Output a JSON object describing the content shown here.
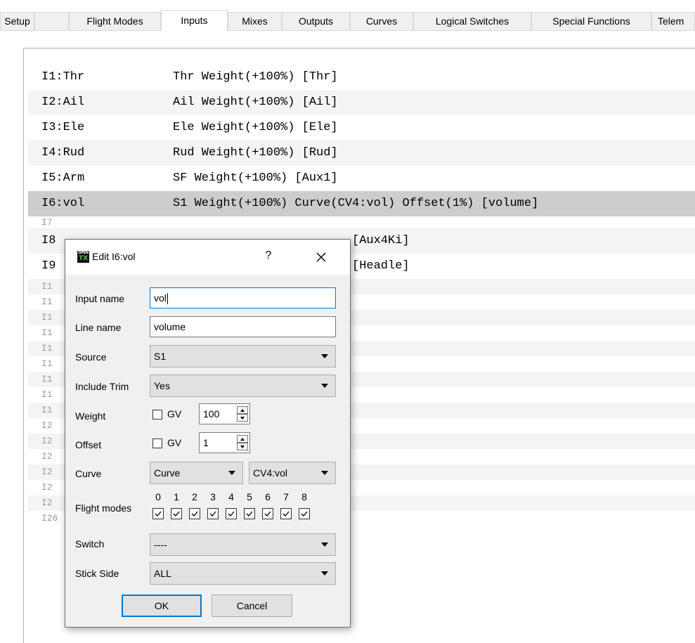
{
  "tabs": [
    "Setup",
    "Flight Modes",
    "Inputs",
    "Mixes",
    "Outputs",
    "Curves",
    "Logical Switches",
    "Special Functions",
    "Telem"
  ],
  "active_tab": "Inputs",
  "inputs": [
    {
      "name": "I1:Thr",
      "desc": "Thr Weight(+100%) [Thr]"
    },
    {
      "name": "I2:Ail",
      "desc": "Ail Weight(+100%) [Ail]"
    },
    {
      "name": "I3:Ele",
      "desc": "Ele Weight(+100%) [Ele]"
    },
    {
      "name": "I4:Rud",
      "desc": "Rud Weight(+100%) [Rud]"
    },
    {
      "name": "I5:Arm",
      "desc": "SF Weight(+100%) [Aux1]"
    },
    {
      "name": "I6:vol",
      "desc": "S1 Weight(+100%) Curve(CV4:vol) Offset(1%) [volume]"
    },
    {
      "name": "I7",
      "desc": ""
    },
    {
      "name": "I8",
      "desc": "[Aux4Ki]"
    },
    {
      "name": "I9",
      "desc": "[Headle]"
    }
  ],
  "empty_inputs": [
    "I1",
    "I1",
    "I1",
    "I1",
    "I1",
    "I1",
    "I1",
    "I1",
    "I1",
    "I2",
    "I2",
    "I2",
    "I2",
    "I2",
    "I2",
    "I26"
  ],
  "dialog": {
    "title": "Edit I6:vol",
    "help": "?",
    "logo_top": "OPEN",
    "logo_bottom": "TX",
    "input_name_label": "Input name",
    "input_name_value": "vol",
    "line_name_label": "Line name",
    "line_name_value": "volume",
    "source_label": "Source",
    "source_value": "S1",
    "include_trim_label": "Include Trim",
    "include_trim_value": "Yes",
    "weight_label": "Weight",
    "weight_gv_label": "GV",
    "weight_value": "100",
    "offset_label": "Offset",
    "offset_gv_label": "GV",
    "offset_value": "1",
    "curve_label": "Curve",
    "curve_type_value": "Curve",
    "curve_value": "CV4:vol",
    "flight_modes_label": "Flight modes",
    "flight_modes": [
      "0",
      "1",
      "2",
      "3",
      "4",
      "5",
      "6",
      "7",
      "8"
    ],
    "flight_modes_checked": [
      true,
      true,
      true,
      true,
      true,
      true,
      true,
      true,
      true
    ],
    "switch_label": "Switch",
    "switch_value": "----",
    "stick_side_label": "Stick Side",
    "stick_side_value": "ALL",
    "ok_label": "OK",
    "cancel_label": "Cancel"
  }
}
